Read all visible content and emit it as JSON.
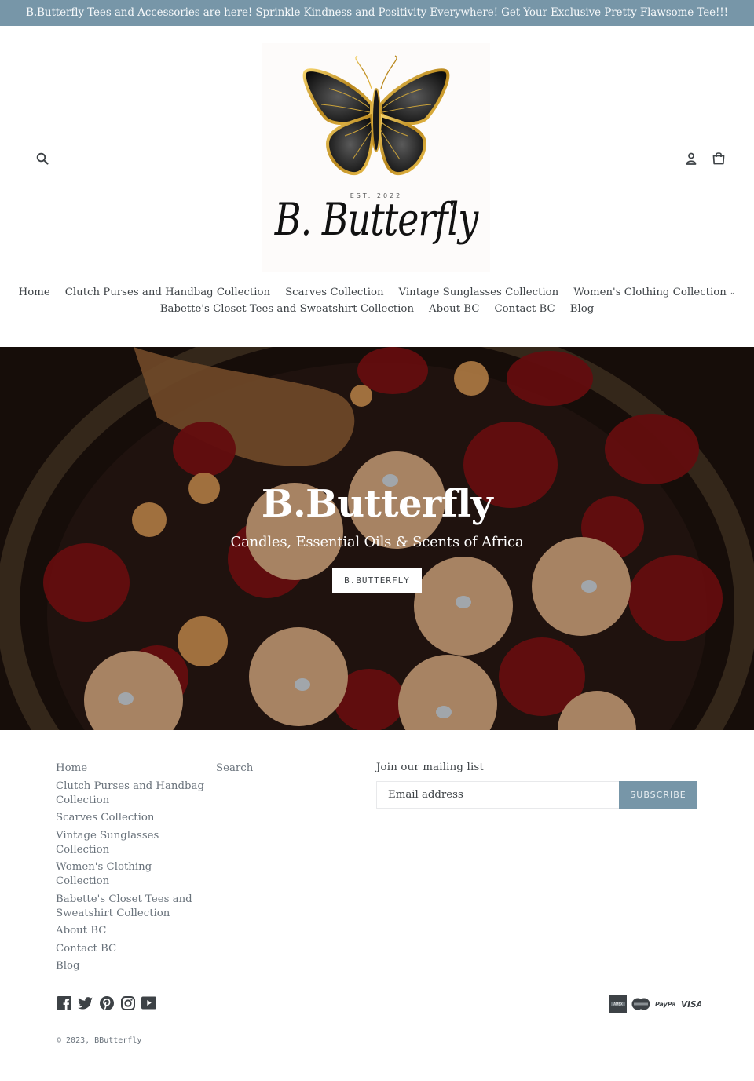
{
  "announcement": "B.Butterfly Tees and Accessories are here! Sprinkle Kindness and Positivity Everywhere! Get Your Exclusive Pretty Flawsome Tee!!!",
  "header": {
    "logo": {
      "est": "EST. 2022",
      "script": "B. Butterfly"
    },
    "icons": {
      "search": "search-icon",
      "account": "user-icon",
      "cart": "shopping-bag-icon"
    }
  },
  "nav": {
    "row1": [
      {
        "label": "Home"
      },
      {
        "label": "Clutch Purses and Handbag Collection"
      },
      {
        "label": "Scarves Collection"
      },
      {
        "label": "Vintage Sunglasses Collection"
      },
      {
        "label": "Women's Clothing Collection",
        "has_dropdown": true
      }
    ],
    "row2": [
      {
        "label": "Babette's Closet Tees and Sweatshirt Collection"
      },
      {
        "label": "About BC"
      },
      {
        "label": "Contact BC"
      },
      {
        "label": "Blog"
      }
    ]
  },
  "hero": {
    "title": "B.Butterfly",
    "subtitle": "Candles, Essential Oils & Scents of Africa",
    "button": "B.BUTTERFLY"
  },
  "footer": {
    "links_main": [
      "Home",
      "Clutch Purses and Handbag Collection",
      "Scarves Collection",
      "Vintage Sunglasses Collection",
      "Women's Clothing Collection",
      "Babette's Closet Tees and Sweatshirt Collection",
      "About BC",
      "Contact BC",
      "Blog"
    ],
    "links_secondary": [
      "Search"
    ],
    "newsletter": {
      "title": "Join our mailing list",
      "placeholder": "Email address",
      "button": "SUBSCRIBE"
    },
    "social": [
      "facebook-icon",
      "twitter-icon",
      "pinterest-icon",
      "instagram-icon",
      "youtube-icon"
    ],
    "payments": [
      "American Express",
      "Mastercard",
      "PayPal",
      "VISA"
    ],
    "copyright": "© 2023, BButterfly"
  },
  "colors": {
    "accent": "#7796a8",
    "text": "#3d4246",
    "muted": "#69727b"
  }
}
